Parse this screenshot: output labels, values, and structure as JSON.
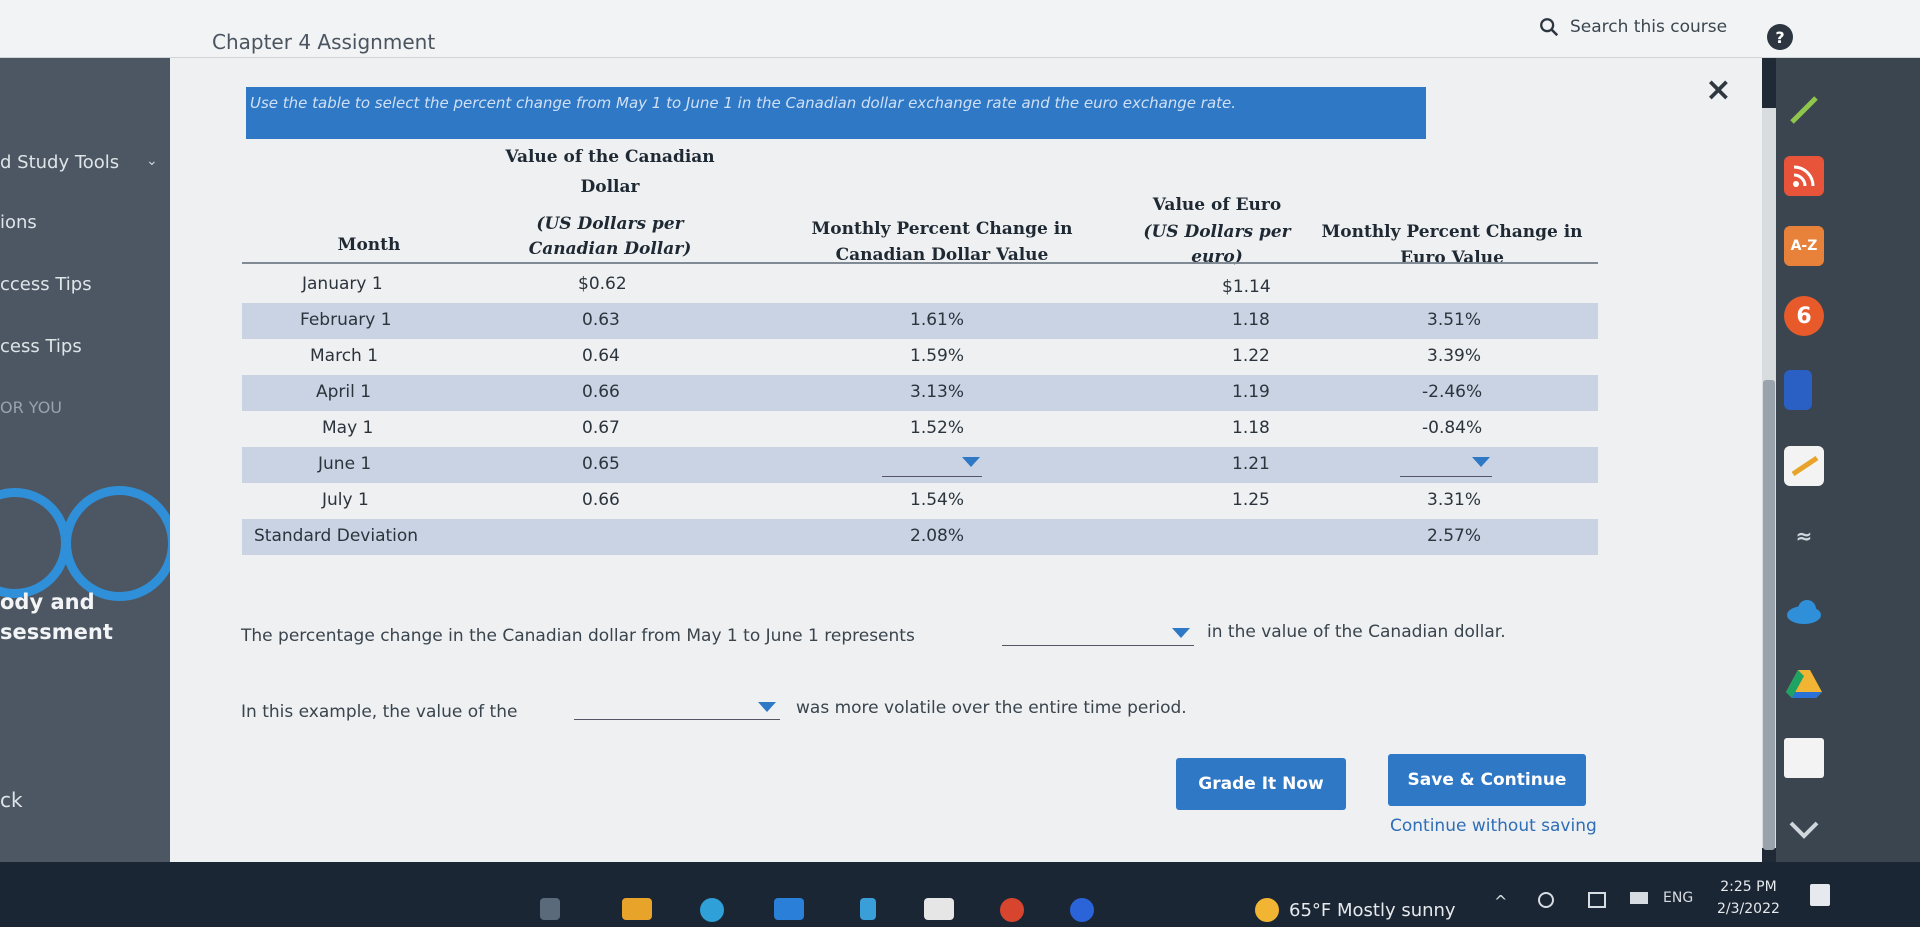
{
  "header": {
    "title": "Chapter 4 Assignment",
    "search_label": "Search this course",
    "help_label": "?"
  },
  "sidebar": {
    "items": [
      {
        "label": "d Study Tools"
      },
      {
        "label": "ions"
      },
      {
        "label": "ccess Tips"
      },
      {
        "label": "cess Tips"
      },
      {
        "label": "OR YOU"
      },
      {
        "label": "ody and"
      },
      {
        "label": "sessment"
      },
      {
        "label": "ck"
      }
    ]
  },
  "assignment": {
    "close_label": "×",
    "instruction": "Use the table to select the percent change from May 1 to June 1 in the Canadian dollar exchange rate and the euro exchange rate.",
    "table": {
      "headers": {
        "month": "Month",
        "cad_value_line1": "Value of the Canadian",
        "cad_value_line2": "Dollar",
        "cad_value_line3": "(US Dollars per",
        "cad_value_line4": "Canadian Dollar)",
        "cad_change_line1": "Monthly Percent Change in",
        "cad_change_line2": "Canadian Dollar Value",
        "euro_value_line1": "Value of Euro",
        "euro_value_line2": "(US Dollars per",
        "euro_value_line3": "euro)",
        "euro_change_line1": "Monthly Percent Change in",
        "euro_change_line2": "Euro Value"
      },
      "rows": [
        {
          "month": "January 1",
          "cad": "$0.62",
          "cad_change": "",
          "euro": "$1.14",
          "euro_change": ""
        },
        {
          "month": "February 1",
          "cad": "0.63",
          "cad_change": "1.61%",
          "euro": "1.18",
          "euro_change": "3.51%"
        },
        {
          "month": "March 1",
          "cad": "0.64",
          "cad_change": "1.59%",
          "euro": "1.22",
          "euro_change": "3.39%"
        },
        {
          "month": "April 1",
          "cad": "0.66",
          "cad_change": "3.13%",
          "euro": "1.19",
          "euro_change": "-2.46%"
        },
        {
          "month": "May 1",
          "cad": "0.67",
          "cad_change": "1.52%",
          "euro": "1.18",
          "euro_change": "-0.84%"
        },
        {
          "month": "June 1",
          "cad": "0.65",
          "cad_change": "",
          "euro": "1.21",
          "euro_change": ""
        },
        {
          "month": "July 1",
          "cad": "0.66",
          "cad_change": "1.54%",
          "euro": "1.25",
          "euro_change": "3.31%"
        }
      ],
      "std_dev": {
        "label": "Standard Deviation",
        "cad_change": "2.08%",
        "euro_change": "2.57%"
      }
    },
    "question1": {
      "prefix": "The percentage change in the Canadian dollar from May 1 to June 1 represents",
      "suffix": "in the value of the Canadian dollar."
    },
    "question2": {
      "prefix": "In this example, the value of the",
      "suffix": "was more volatile over the entire time period."
    },
    "buttons": {
      "grade": "Grade It Now",
      "save": "Save & Continue",
      "continue": "Continue without saving"
    }
  },
  "rightbar": {
    "az_label": "A-Z",
    "six_label": "6"
  },
  "taskbar": {
    "weather": "65°F  Mostly sunny",
    "lang": "ENG",
    "time": "2:25 PM",
    "date": "2/3/2022"
  },
  "colors": {
    "accent": "#2f78c6",
    "row_shade": "#c9d3e3",
    "sidebar": "#4c5763",
    "ring": "#2f8fd8"
  }
}
